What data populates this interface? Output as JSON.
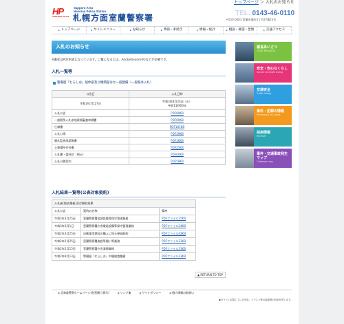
{
  "header": {
    "logo_mark": "HP",
    "logo_mark_sub": "HOKKAIDO POLICE",
    "logo_sub_en1": "Sapporo Area",
    "logo_sub_en2": "Nanoran Police Station",
    "logo_title": "札幌方面室蘭警察署",
    "breadcrumb_home": "トップページ",
    "breadcrumb_sep": "＞",
    "breadcrumb_current": "入札のお知らせ",
    "tel_prefix": "TEL.",
    "tel_number": "0143-46-0110",
    "address": "〒050-0083 室蘭市東町4丁目27番20号"
  },
  "nav": [
    {
      "label": "トップページ",
      "name": "nav-top"
    },
    {
      "label": "サイトメニュー",
      "name": "nav-site-menu"
    },
    {
      "label": "お知らせ",
      "name": "nav-news"
    },
    {
      "label": "申請・手続き",
      "name": "nav-procedures"
    },
    {
      "label": "情報・統計",
      "name": "nav-statistics"
    },
    {
      "label": "相談・要望・苦情",
      "name": "nav-consultation"
    },
    {
      "label": "交通アクセス",
      "name": "nav-access"
    }
  ],
  "main": {
    "title": "入札のお知らせ",
    "note": "※書式はPDF形式になっています。ご覧になるには、AdobeReader(R)などが必要です。",
    "section1_title": "入札一覧等",
    "section1_item": "警備艇「むらしお」船体部及び機関部ほか一般整備（一般競争入札）",
    "table1": {
      "header_left": "公告日",
      "header_right": "入札日時",
      "date_left": "令和3年7月27日",
      "date_right_1": "令和3年8月24日（火）",
      "date_right_2": "午前11時00分",
      "rows": [
        {
          "name": "入札公告",
          "link": "PDF89KB"
        },
        {
          "name": "一般競争入札参加資格審査申請書",
          "link": "PDF69KB"
        },
        {
          "name": "仕様書",
          "link": "PDF185KB"
        },
        {
          "name": "入札心得",
          "link": "PDF39KB"
        },
        {
          "name": "開札監視承諾誓書",
          "link": "PDF36KB"
        },
        {
          "name": "上質場所付合書",
          "link": "PDF25KB"
        },
        {
          "name": "入札書・委任状（例示）",
          "link": "PDF60KB"
        },
        {
          "name": "入札公開案内",
          "link": "PDF58KB"
        }
      ]
    },
    "section2_title": "入札結果一覧等(公表対象契約)",
    "table2": {
      "caption": "入札者(指名業者)及び開札結果",
      "col1": "入札公告",
      "col2": "契約の名称",
      "col3": "備考",
      "rows": [
        {
          "date": "令和3年3月25日",
          "name": "室蘭警察署室調設備等保守管理業務",
          "link": "PDFファイル25KB"
        },
        {
          "date": "令和3年3月1日",
          "name": "室蘭警察署庁舎電話設備等保守管理業務",
          "link": "PDFファイル24KB"
        },
        {
          "date": "令和2年3月25日",
          "name": "自動車用燃料の購入に係る単価契約",
          "link": "PDFファイル43KB"
        },
        {
          "date": "令和2年2月25日",
          "name": "室蘭警察署施設等開い等業務",
          "link": "PDFファイル23KB"
        },
        {
          "date": "令和2年2月15日",
          "name": "室蘭警察署庁舎清掃業務",
          "link": "PDFファイル31KB"
        },
        {
          "date": "令和2年8月13日",
          "name": "警備艇「むらしお」中間検査整備",
          "link": "PDFファイル23KB"
        }
      ]
    },
    "return_top": "RETURN TO TOP"
  },
  "sidebar": [
    {
      "label": "署長あいさつ",
      "sub": "CHIEF MESSAGE",
      "color": "#7cc242"
    },
    {
      "label": "安全・安心なくらし",
      "sub": "Secure and Safe Living",
      "color": "#e7357a"
    },
    {
      "label": "交通安全",
      "sub": "Traffic Safety",
      "color": "#2f9fe0"
    },
    {
      "label": "事件・犯罪の情報",
      "sub": "Prevention of Crimes",
      "color": "#f39a1e"
    },
    {
      "label": "採用情報",
      "sub": "RECRUIT",
      "color": "#2aa6b4"
    },
    {
      "label": "事件・交通事故発生マップ",
      "sub": "Outbreak map",
      "color": "#8a4fb8"
    }
  ],
  "footer": {
    "links": [
      "北海道警察ホームページ(別窓開で表示)",
      "リンク集",
      "サイトポリシー",
      "個人情報の取扱い"
    ],
    "copyright": "●サイトに記載している写真、イラスト等の転載等の利用を禁じます。"
  },
  "colors": {
    "accent": "#2a8fd0",
    "brand": "#1b4d9a",
    "logo_red": "#e3211c"
  }
}
